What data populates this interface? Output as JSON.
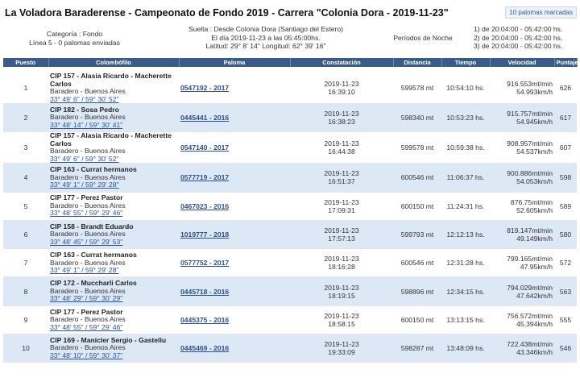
{
  "header": {
    "title": "La Voladora Baraderense - Campeonato de Fondo 2019 - Carrera \"Colonia Dora - 2019-11-23\"",
    "badge": "10 palomas marcadas"
  },
  "info": {
    "categoria": "Categoría : Fondo",
    "linea": "Línea 5 - 0 palomas enviadas",
    "suelta": "Suelta : Desde Colonia Dora (Santiago del Estero)",
    "dia": "El día 2019-11-23 a las 05:45:00hs.",
    "coords": "Latitud: 29° 8' 14\" Longitud: 62° 39' 16\"",
    "periodos_label": "Períodos de Noche",
    "periodos": [
      "1) de 20:04:00 - 05:42:00 hs.",
      "2) de 20:04:00 - 05:42:00 hs.",
      "3) de 20:04:00 - 05:42:00 hs."
    ]
  },
  "table": {
    "columns": [
      "Puesto",
      "Colombófilo",
      "Paloma",
      "Constatación",
      "Distancia",
      "Tiempo",
      "Velocidad",
      "Puntaje"
    ],
    "rows": [
      {
        "puesto": "1",
        "name": "CIP 157 - Alasia Ricardo - Macherette Carlos",
        "place": "Baradero - Buenos Aires",
        "coord": "33° 49' 6\" / 59° 30' 52\"",
        "paloma": "0547192 - 2017",
        "date": "2019-11-23",
        "time": "16:39:10",
        "dist": "599578 mt",
        "tiempo": "10:54:10 hs.",
        "vel1": "916.553mt/min",
        "vel2": "54.993km/h",
        "pts": "626"
      },
      {
        "puesto": "2",
        "name": "CIP 182 - Sosa Pedro",
        "place": "Baradero - Buenos Aires",
        "coord": "33° 48' 14\" / 59° 30' 41\"",
        "paloma": "0445441 - 2016",
        "date": "2019-11-23",
        "time": "16:38:23",
        "dist": "598340 mt",
        "tiempo": "10:53:23 hs.",
        "vel1": "915.757mt/min",
        "vel2": "54.945km/h",
        "pts": "617"
      },
      {
        "puesto": "3",
        "name": "CIP 157 - Alasia Ricardo - Macherette Carlos",
        "place": "Baradero - Buenos Aires",
        "coord": "33° 49' 6\" / 59° 30' 52\"",
        "paloma": "0547140 - 2017",
        "date": "2019-11-23",
        "time": "16:44:38",
        "dist": "599578 mt",
        "tiempo": "10:59:38 hs.",
        "vel1": "908.957mt/min",
        "vel2": "54.537km/h",
        "pts": "607"
      },
      {
        "puesto": "4",
        "name": "CIP 163 - Currat hermanos",
        "place": "Baradero - Buenos Aires",
        "coord": "33° 49' 1\" / 59° 29' 28\"",
        "paloma": "0577719 - 2017",
        "date": "2019-11-23",
        "time": "16:51:37",
        "dist": "600546 mt",
        "tiempo": "11:06:37 hs.",
        "vel1": "900.886mt/min",
        "vel2": "54.053km/h",
        "pts": "598"
      },
      {
        "puesto": "5",
        "name": "CIP 177 - Perez Pastor",
        "place": "Baradero - Buenos Aires",
        "coord": "33° 48' 55\" / 59° 29' 46\"",
        "paloma": "0467023 - 2016",
        "date": "2019-11-23",
        "time": "17:09:31",
        "dist": "600150 mt",
        "tiempo": "11:24:31 hs.",
        "vel1": "876.75mt/min",
        "vel2": "52.605km/h",
        "pts": "589"
      },
      {
        "puesto": "6",
        "name": "CIP 158 - Brandt Eduardo",
        "place": "Baradero - Buenos Aires",
        "coord": "33° 48' 45\" / 59° 29' 53\"",
        "paloma": "1019777 - 2018",
        "date": "2019-11-23",
        "time": "17:57:13",
        "dist": "599793 mt",
        "tiempo": "12:12:13 hs.",
        "vel1": "819.147mt/min",
        "vel2": "49.149km/h",
        "pts": "580"
      },
      {
        "puesto": "7",
        "name": "CIP 163 - Currat hermanos",
        "place": "Baradero - Buenos Aires",
        "coord": "33° 49' 1\" / 59° 29' 28\"",
        "paloma": "0577752 - 2017",
        "date": "2019-11-23",
        "time": "18:16:28",
        "dist": "600546 mt",
        "tiempo": "12:31:28 hs.",
        "vel1": "799.165mt/min",
        "vel2": "47.95km/h",
        "pts": "572"
      },
      {
        "puesto": "8",
        "name": "CIP 172 - Muccharli Carlos",
        "place": "Baradero - Buenos Aires",
        "coord": "33° 48' 29\" / 59° 30' 29\"",
        "paloma": "0445718 - 2016",
        "date": "2019-11-23",
        "time": "18:19:15",
        "dist": "598896 mt",
        "tiempo": "12:34:15 hs.",
        "vel1": "794.029mt/min",
        "vel2": "47.642km/h",
        "pts": "563"
      },
      {
        "puesto": "9",
        "name": "CIP 177 - Perez Pastor",
        "place": "Baradero - Buenos Aires",
        "coord": "33° 48' 55\" / 59° 29' 46\"",
        "paloma": "0445375 - 2016",
        "date": "2019-11-23",
        "time": "18:58:15",
        "dist": "600150 mt",
        "tiempo": "13:13:15 hs.",
        "vel1": "756.572mt/min",
        "vel2": "45.394km/h",
        "pts": "555"
      },
      {
        "puesto": "10",
        "name": "CIP 169 - Manicler Sergio - Gastellu",
        "place": "Baradero - Buenos Aires",
        "coord": "33° 48' 10\" / 59° 30' 37\"",
        "paloma": "0445469 - 2016",
        "date": "2019-11-23",
        "time": "19:33:09",
        "dist": "598287 mt",
        "tiempo": "13:48:09 hs.",
        "vel1": "722.438mt/min",
        "vel2": "43.346km/h",
        "pts": "546"
      }
    ]
  }
}
